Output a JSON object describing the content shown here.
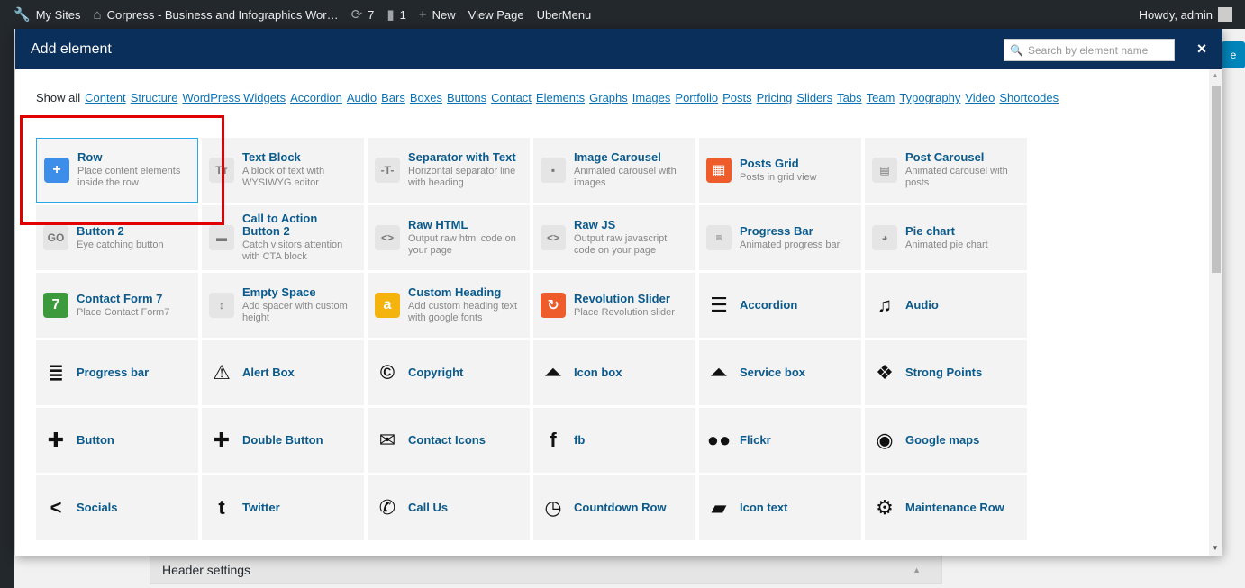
{
  "adminbar": {
    "my_sites": "My Sites",
    "site_name": "Corpress - Business and Infographics Wor…",
    "updates_count": "7",
    "comments_count": "1",
    "new_label": "New",
    "view_page": "View Page",
    "ubermenu": "UberMenu",
    "howdy": "Howdy, admin"
  },
  "background": {
    "header_settings": "Header settings",
    "blue_btn_fragment": "e"
  },
  "modal": {
    "title": "Add element",
    "search_placeholder": "Search by element name",
    "close": "×"
  },
  "filters": [
    "Show all",
    "Content",
    "Structure",
    "WordPress Widgets",
    "Accordion",
    "Audio",
    "Bars",
    "Boxes",
    "Buttons",
    "Contact",
    "Elements",
    "Graphs",
    "Images",
    "Portfolio",
    "Posts",
    "Pricing",
    "Sliders",
    "Tabs",
    "Team",
    "Typography",
    "Video",
    "Shortcodes"
  ],
  "elements": [
    {
      "name": "Row",
      "desc": "Place content elements inside the row",
      "icon": "plus-icon",
      "glyph": "+",
      "color": "#3d8ee8"
    },
    {
      "name": "Text Block",
      "desc": "A block of text with WYSIWYG editor",
      "icon": "text-icon",
      "glyph": "Tт",
      "color": "#e5e5e5"
    },
    {
      "name": "Separator with Text",
      "desc": "Horizontal separator line with heading",
      "icon": "separator-icon",
      "glyph": "-T-",
      "color": "#e5e5e5"
    },
    {
      "name": "Image Carousel",
      "desc": "Animated carousel with images",
      "icon": "image-carousel-icon",
      "glyph": "▪",
      "color": "#e5e5e5"
    },
    {
      "name": "Posts Grid",
      "desc": "Posts in grid view",
      "icon": "posts-grid-icon",
      "glyph": "▦",
      "color": "#ef5c2b"
    },
    {
      "name": "Post Carousel",
      "desc": "Animated carousel with posts",
      "icon": "post-carousel-icon",
      "glyph": "▤",
      "color": "#e5e5e5"
    },
    {
      "name": "Button 2",
      "desc": "Eye catching button",
      "icon": "button-icon",
      "glyph": "GO",
      "color": "#e5e5e5"
    },
    {
      "name": "Call to Action Button 2",
      "desc": "Catch visitors attention with CTA block",
      "icon": "cta-icon",
      "glyph": "▬",
      "color": "#e5e5e5"
    },
    {
      "name": "Raw HTML",
      "desc": "Output raw html code on your page",
      "icon": "html-icon",
      "glyph": "<>",
      "color": "#e5e5e5"
    },
    {
      "name": "Raw JS",
      "desc": "Output raw javascript code on your page",
      "icon": "js-icon",
      "glyph": "<>",
      "color": "#e5e5e5"
    },
    {
      "name": "Progress Bar",
      "desc": "Animated progress bar",
      "icon": "progress-bar-icon",
      "glyph": "≡",
      "color": "#e5e5e5"
    },
    {
      "name": "Pie chart",
      "desc": "Animated pie chart",
      "icon": "pie-chart-icon",
      "glyph": "◕",
      "color": "#e5e5e5"
    },
    {
      "name": "Contact Form 7",
      "desc": "Place Contact Form7",
      "icon": "contact-form-icon",
      "glyph": "7",
      "color": "#3c9a3c"
    },
    {
      "name": "Empty Space",
      "desc": "Add spacer with custom height",
      "icon": "empty-space-icon",
      "glyph": "↕",
      "color": "#e5e5e5"
    },
    {
      "name": "Custom Heading",
      "desc": "Add custom heading text with google fonts",
      "icon": "custom-heading-icon",
      "glyph": "a",
      "color": "#f5b30d"
    },
    {
      "name": "Revolution Slider",
      "desc": "Place Revolution slider",
      "icon": "revolution-slider-icon",
      "glyph": "↻",
      "color": "#ef5c2b"
    },
    {
      "name": "Accordion",
      "desc": "",
      "icon": "menu-icon",
      "glyph": "☰",
      "color": ""
    },
    {
      "name": "Audio",
      "desc": "",
      "icon": "music-icon",
      "glyph": "♫",
      "color": ""
    },
    {
      "name": "Progress bar",
      "desc": "",
      "icon": "align-left-icon",
      "glyph": "≣",
      "color": ""
    },
    {
      "name": "Alert Box",
      "desc": "",
      "icon": "warning-icon",
      "glyph": "⚠",
      "color": ""
    },
    {
      "name": "Copyright",
      "desc": "",
      "icon": "copyright-icon",
      "glyph": "©",
      "color": ""
    },
    {
      "name": "Icon box",
      "desc": "",
      "icon": "caret-square-icon",
      "glyph": "⏶",
      "color": ""
    },
    {
      "name": "Service box",
      "desc": "",
      "icon": "caret-square-icon",
      "glyph": "⏶",
      "color": ""
    },
    {
      "name": "Strong Points",
      "desc": "",
      "icon": "vc-logo-icon",
      "glyph": "❖",
      "color": ""
    },
    {
      "name": "Button",
      "desc": "",
      "icon": "plus-square-icon",
      "glyph": "✚",
      "color": ""
    },
    {
      "name": "Double Button",
      "desc": "",
      "icon": "plus-square-icon",
      "glyph": "✚",
      "color": ""
    },
    {
      "name": "Contact Icons",
      "desc": "",
      "icon": "envelope-icon",
      "glyph": "✉",
      "color": ""
    },
    {
      "name": "fb",
      "desc": "",
      "icon": "facebook-icon",
      "glyph": "f",
      "color": ""
    },
    {
      "name": "Flickr",
      "desc": "",
      "icon": "flickr-icon",
      "glyph": "●●",
      "color": ""
    },
    {
      "name": "Google maps",
      "desc": "",
      "icon": "globe-icon",
      "glyph": "◉",
      "color": ""
    },
    {
      "name": "Socials",
      "desc": "",
      "icon": "share-icon",
      "glyph": "<",
      "color": ""
    },
    {
      "name": "Twitter",
      "desc": "",
      "icon": "twitter-icon",
      "glyph": "t",
      "color": ""
    },
    {
      "name": "Call Us",
      "desc": "",
      "icon": "phone-icon",
      "glyph": "✆",
      "color": ""
    },
    {
      "name": "Countdown Row",
      "desc": "",
      "icon": "clock-icon",
      "glyph": "◷",
      "color": ""
    },
    {
      "name": "Icon text",
      "desc": "",
      "icon": "book-icon",
      "glyph": "▰",
      "color": ""
    },
    {
      "name": "Maintenance Row",
      "desc": "",
      "icon": "cogs-icon",
      "glyph": "⚙",
      "color": ""
    }
  ]
}
